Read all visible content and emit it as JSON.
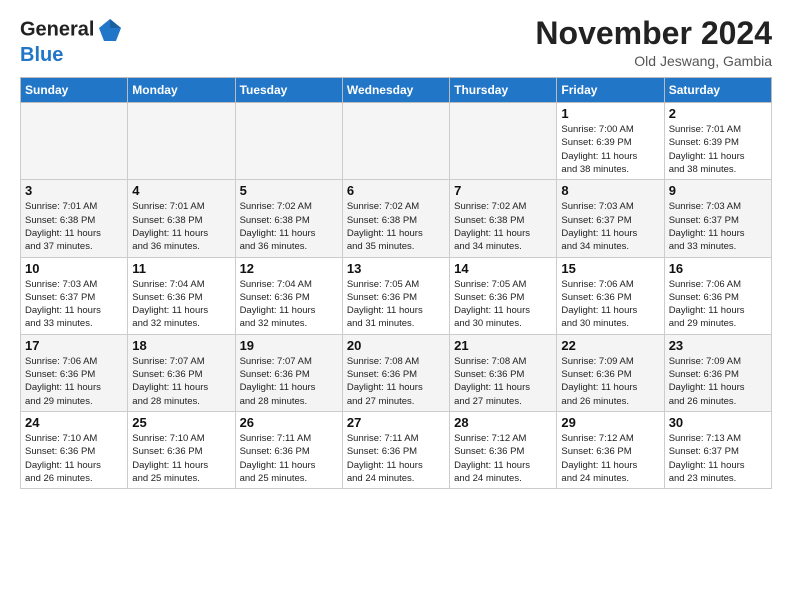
{
  "header": {
    "logo_line1": "General",
    "logo_line2": "Blue",
    "month_title": "November 2024",
    "subtitle": "Old Jeswang, Gambia"
  },
  "columns": [
    "Sunday",
    "Monday",
    "Tuesday",
    "Wednesday",
    "Thursday",
    "Friday",
    "Saturday"
  ],
  "weeks": [
    [
      {
        "day": "",
        "info": ""
      },
      {
        "day": "",
        "info": ""
      },
      {
        "day": "",
        "info": ""
      },
      {
        "day": "",
        "info": ""
      },
      {
        "day": "",
        "info": ""
      },
      {
        "day": "1",
        "info": "Sunrise: 7:00 AM\nSunset: 6:39 PM\nDaylight: 11 hours\nand 38 minutes."
      },
      {
        "day": "2",
        "info": "Sunrise: 7:01 AM\nSunset: 6:39 PM\nDaylight: 11 hours\nand 38 minutes."
      }
    ],
    [
      {
        "day": "3",
        "info": "Sunrise: 7:01 AM\nSunset: 6:38 PM\nDaylight: 11 hours\nand 37 minutes."
      },
      {
        "day": "4",
        "info": "Sunrise: 7:01 AM\nSunset: 6:38 PM\nDaylight: 11 hours\nand 36 minutes."
      },
      {
        "day": "5",
        "info": "Sunrise: 7:02 AM\nSunset: 6:38 PM\nDaylight: 11 hours\nand 36 minutes."
      },
      {
        "day": "6",
        "info": "Sunrise: 7:02 AM\nSunset: 6:38 PM\nDaylight: 11 hours\nand 35 minutes."
      },
      {
        "day": "7",
        "info": "Sunrise: 7:02 AM\nSunset: 6:38 PM\nDaylight: 11 hours\nand 34 minutes."
      },
      {
        "day": "8",
        "info": "Sunrise: 7:03 AM\nSunset: 6:37 PM\nDaylight: 11 hours\nand 34 minutes."
      },
      {
        "day": "9",
        "info": "Sunrise: 7:03 AM\nSunset: 6:37 PM\nDaylight: 11 hours\nand 33 minutes."
      }
    ],
    [
      {
        "day": "10",
        "info": "Sunrise: 7:03 AM\nSunset: 6:37 PM\nDaylight: 11 hours\nand 33 minutes."
      },
      {
        "day": "11",
        "info": "Sunrise: 7:04 AM\nSunset: 6:36 PM\nDaylight: 11 hours\nand 32 minutes."
      },
      {
        "day": "12",
        "info": "Sunrise: 7:04 AM\nSunset: 6:36 PM\nDaylight: 11 hours\nand 32 minutes."
      },
      {
        "day": "13",
        "info": "Sunrise: 7:05 AM\nSunset: 6:36 PM\nDaylight: 11 hours\nand 31 minutes."
      },
      {
        "day": "14",
        "info": "Sunrise: 7:05 AM\nSunset: 6:36 PM\nDaylight: 11 hours\nand 30 minutes."
      },
      {
        "day": "15",
        "info": "Sunrise: 7:06 AM\nSunset: 6:36 PM\nDaylight: 11 hours\nand 30 minutes."
      },
      {
        "day": "16",
        "info": "Sunrise: 7:06 AM\nSunset: 6:36 PM\nDaylight: 11 hours\nand 29 minutes."
      }
    ],
    [
      {
        "day": "17",
        "info": "Sunrise: 7:06 AM\nSunset: 6:36 PM\nDaylight: 11 hours\nand 29 minutes."
      },
      {
        "day": "18",
        "info": "Sunrise: 7:07 AM\nSunset: 6:36 PM\nDaylight: 11 hours\nand 28 minutes."
      },
      {
        "day": "19",
        "info": "Sunrise: 7:07 AM\nSunset: 6:36 PM\nDaylight: 11 hours\nand 28 minutes."
      },
      {
        "day": "20",
        "info": "Sunrise: 7:08 AM\nSunset: 6:36 PM\nDaylight: 11 hours\nand 27 minutes."
      },
      {
        "day": "21",
        "info": "Sunrise: 7:08 AM\nSunset: 6:36 PM\nDaylight: 11 hours\nand 27 minutes."
      },
      {
        "day": "22",
        "info": "Sunrise: 7:09 AM\nSunset: 6:36 PM\nDaylight: 11 hours\nand 26 minutes."
      },
      {
        "day": "23",
        "info": "Sunrise: 7:09 AM\nSunset: 6:36 PM\nDaylight: 11 hours\nand 26 minutes."
      }
    ],
    [
      {
        "day": "24",
        "info": "Sunrise: 7:10 AM\nSunset: 6:36 PM\nDaylight: 11 hours\nand 26 minutes."
      },
      {
        "day": "25",
        "info": "Sunrise: 7:10 AM\nSunset: 6:36 PM\nDaylight: 11 hours\nand 25 minutes."
      },
      {
        "day": "26",
        "info": "Sunrise: 7:11 AM\nSunset: 6:36 PM\nDaylight: 11 hours\nand 25 minutes."
      },
      {
        "day": "27",
        "info": "Sunrise: 7:11 AM\nSunset: 6:36 PM\nDaylight: 11 hours\nand 24 minutes."
      },
      {
        "day": "28",
        "info": "Sunrise: 7:12 AM\nSunset: 6:36 PM\nDaylight: 11 hours\nand 24 minutes."
      },
      {
        "day": "29",
        "info": "Sunrise: 7:12 AM\nSunset: 6:36 PM\nDaylight: 11 hours\nand 24 minutes."
      },
      {
        "day": "30",
        "info": "Sunrise: 7:13 AM\nSunset: 6:37 PM\nDaylight: 11 hours\nand 23 minutes."
      }
    ]
  ]
}
